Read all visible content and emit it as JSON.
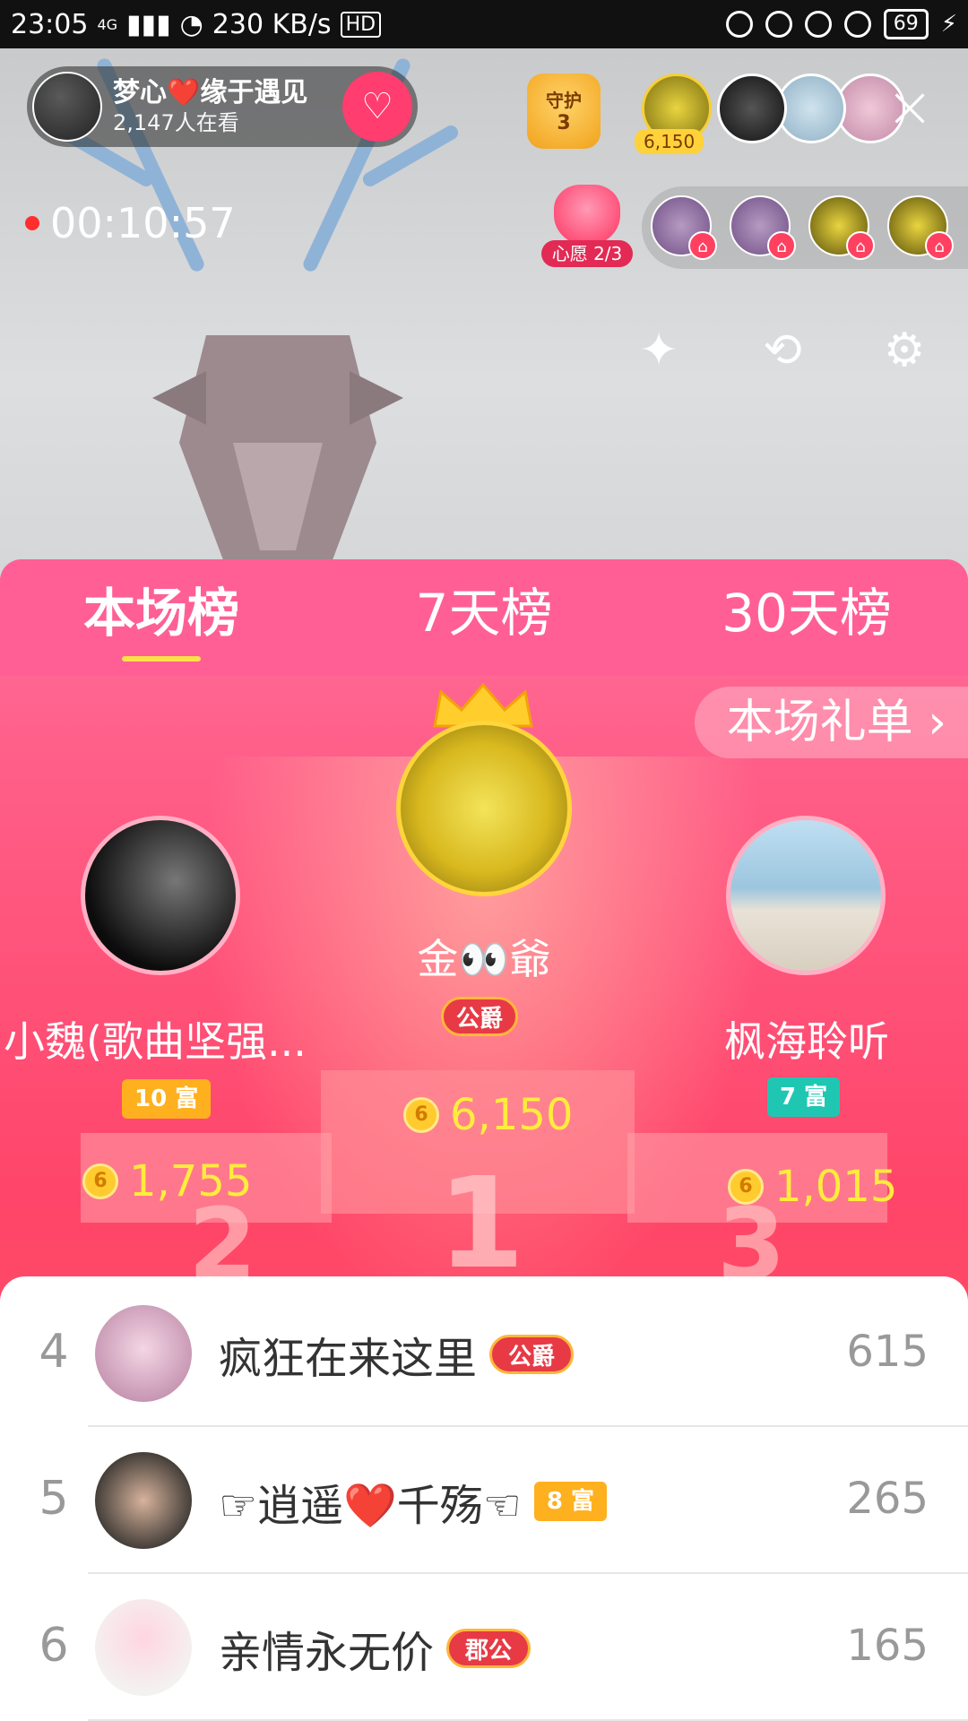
{
  "status_bar": {
    "time": "23:05",
    "network": "4G",
    "speed": "230 KB/s",
    "hd": "HD",
    "battery": "69"
  },
  "host": {
    "name": "梦心❤️缘于遇见",
    "viewers": "2,147人在看",
    "follow_icon": "heart-plus-icon"
  },
  "guard": {
    "label": "守护",
    "count": "3"
  },
  "top_contributor_coins": "6,150",
  "live_timer": "00:10:57",
  "wish": {
    "label": "心愿 2/3"
  },
  "tabs": [
    {
      "label": "本场榜",
      "active": true
    },
    {
      "label": "7天榜",
      "active": false
    },
    {
      "label": "30天榜",
      "active": false
    }
  ],
  "gift_list_link": "本场礼单 ›",
  "podium": {
    "first": {
      "name": "金👀爺",
      "badge": "公爵",
      "coins": "6,150"
    },
    "second": {
      "name": "小魏(歌曲坚强...",
      "badge": "10 富",
      "coins": "1,755"
    },
    "third": {
      "name": "枫海聆听",
      "badge": "7 富",
      "coins": "1,015"
    }
  },
  "ranking": [
    {
      "rank": "4",
      "name": "疯狂在来这里",
      "badge": "公爵",
      "value": "615"
    },
    {
      "rank": "5",
      "name": "☞逍遥❤️千殇☜",
      "badge": "8 富",
      "value": "265"
    },
    {
      "rank": "6",
      "name": "亲情永无价",
      "badge": "郡公",
      "value": "165"
    }
  ],
  "colors": {
    "panel_pink": "#ff5f95",
    "coin_yellow": "#ffec3d",
    "rich_badge": "#ffb01f",
    "noble_badge": "#e73a45",
    "teal_badge": "#1fc7b3"
  }
}
